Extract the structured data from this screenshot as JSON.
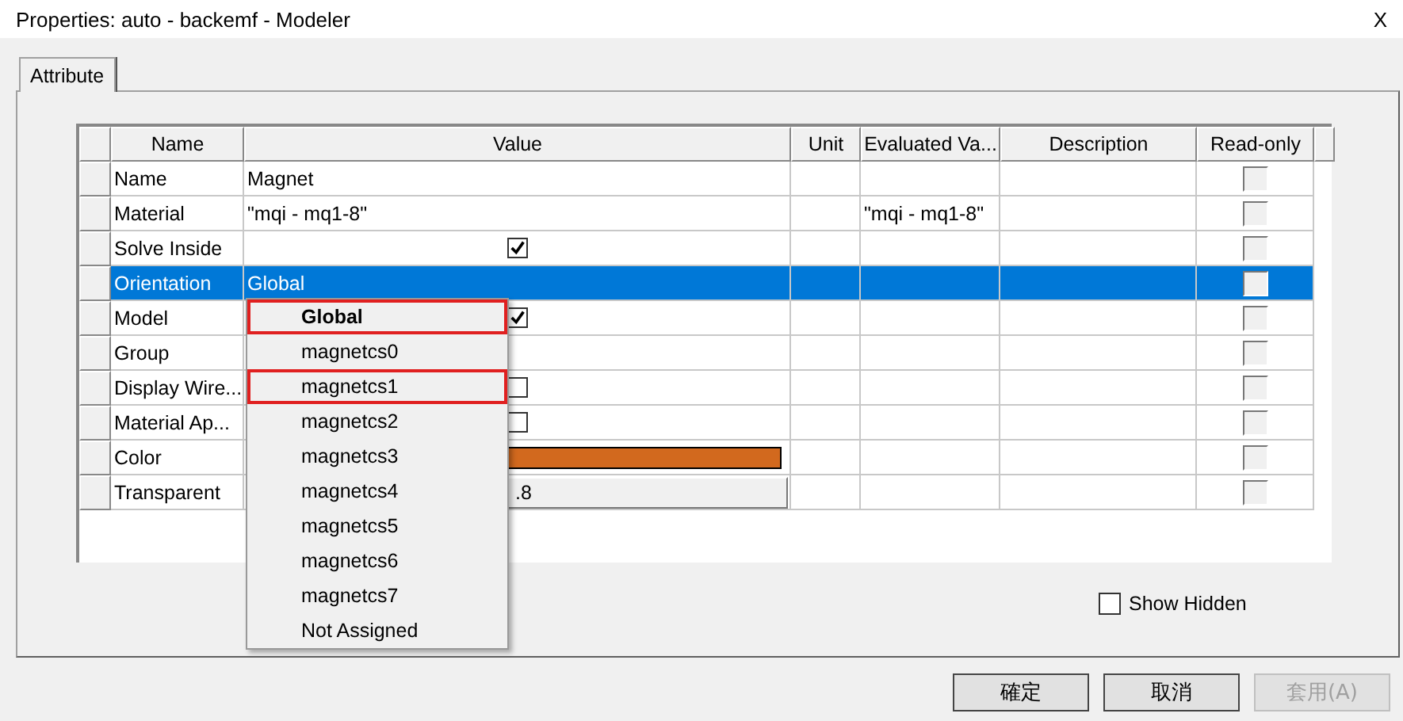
{
  "window": {
    "title": "Properties: auto - backemf - Modeler",
    "close": "X"
  },
  "tabs": [
    {
      "label": "Attribute",
      "selected": true
    }
  ],
  "table": {
    "columns": [
      "Name",
      "Value",
      "Unit",
      "Evaluated Va...",
      "Description",
      "Read-only"
    ],
    "rows": [
      {
        "name": "Name",
        "kind": "text",
        "value": "Magnet",
        "evaluated": "",
        "selected": false,
        "read_only": false
      },
      {
        "name": "Material",
        "kind": "text",
        "value": "\"mqi - mq1-8\"",
        "evaluated": "\"mqi - mq1-8\"",
        "selected": false,
        "read_only": false
      },
      {
        "name": "Solve Inside",
        "kind": "checkbox",
        "checked": true,
        "selected": false,
        "read_only": false
      },
      {
        "name": "Orientation",
        "kind": "text",
        "value": "Global",
        "evaluated": "",
        "selected": true,
        "read_only": false
      },
      {
        "name": "Model",
        "kind": "checkbox",
        "checked": true,
        "selected": false,
        "read_only": false
      },
      {
        "name": "Group",
        "kind": "text",
        "value": "",
        "evaluated": "",
        "selected": false,
        "read_only": false
      },
      {
        "name": "Display Wire...",
        "kind": "checkbox",
        "checked": false,
        "selected": false,
        "read_only": false
      },
      {
        "name": "Material Ap...",
        "kind": "checkbox",
        "checked": false,
        "selected": false,
        "read_only": false
      },
      {
        "name": "Color",
        "kind": "color",
        "color": "#d2691e",
        "selected": false,
        "read_only": false
      },
      {
        "name": "Transparent",
        "kind": "button",
        "value": ".8",
        "selected": false,
        "read_only": false
      }
    ]
  },
  "dropdown": {
    "items": [
      {
        "label": "Global",
        "selected": true,
        "annotated": true
      },
      {
        "label": "magnetcs0",
        "selected": false,
        "annotated": false
      },
      {
        "label": "magnetcs1",
        "selected": false,
        "annotated": true
      },
      {
        "label": "magnetcs2",
        "selected": false,
        "annotated": false
      },
      {
        "label": "magnetcs3",
        "selected": false,
        "annotated": false
      },
      {
        "label": "magnetcs4",
        "selected": false,
        "annotated": false
      },
      {
        "label": "magnetcs5",
        "selected": false,
        "annotated": false
      },
      {
        "label": "magnetcs6",
        "selected": false,
        "annotated": false
      },
      {
        "label": "magnetcs7",
        "selected": false,
        "annotated": false
      },
      {
        "label": "Not Assigned",
        "selected": false,
        "annotated": false
      }
    ]
  },
  "show_hidden": {
    "label": "Show Hidden",
    "checked": false
  },
  "buttons": [
    {
      "label": "確定",
      "disabled": false
    },
    {
      "label": "取消",
      "disabled": false
    },
    {
      "label": "套用(A)",
      "disabled": true
    }
  ]
}
